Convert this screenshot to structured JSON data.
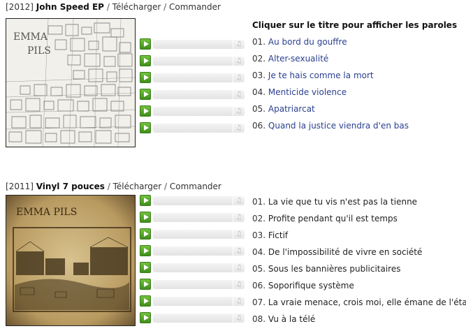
{
  "releases": [
    {
      "year": "[2012]",
      "title": "John Speed EP",
      "download": "Télécharger",
      "order": "Commander",
      "cover_text": "EMMA PILS",
      "lyrics_hint": "Cliquer sur le titre pour afficher les paroles",
      "tracks": [
        {
          "num": "01.",
          "title": "Au bord du gouffre"
        },
        {
          "num": "02.",
          "title": "Alter-sexualité"
        },
        {
          "num": "03.",
          "title": "Je te hais comme la mort"
        },
        {
          "num": "04.",
          "title": "Menticide violence"
        },
        {
          "num": "05.",
          "title": "Apatriarcat"
        },
        {
          "num": "06.",
          "title": "Quand la justice viendra d'en bas"
        }
      ]
    },
    {
      "year": "[2011]",
      "title": "Vinyl 7 pouces",
      "download": "Télécharger",
      "order": "Commander",
      "cover_text": "EMMA PILS",
      "tracks": [
        {
          "num": "01.",
          "title": "La vie que tu vis n'est pas la tienne"
        },
        {
          "num": "02.",
          "title": "Profite pendant qu'il est temps"
        },
        {
          "num": "03.",
          "title": "Fictif"
        },
        {
          "num": "04.",
          "title": "De l'impossibilité de vivre en société"
        },
        {
          "num": "05.",
          "title": "Sous les bannières publicitaires"
        },
        {
          "num": "06.",
          "title": "Soporifique système"
        },
        {
          "num": "07.",
          "title": "La vraie menace, crois moi, elle émane de l'état"
        },
        {
          "num": "08.",
          "title": "Vu à la télé"
        }
      ]
    }
  ],
  "player": {
    "play_icon": "play-icon",
    "volume_icon": "volume-icon",
    "volume_glyph": "♫",
    "accent": "#4fa326"
  }
}
